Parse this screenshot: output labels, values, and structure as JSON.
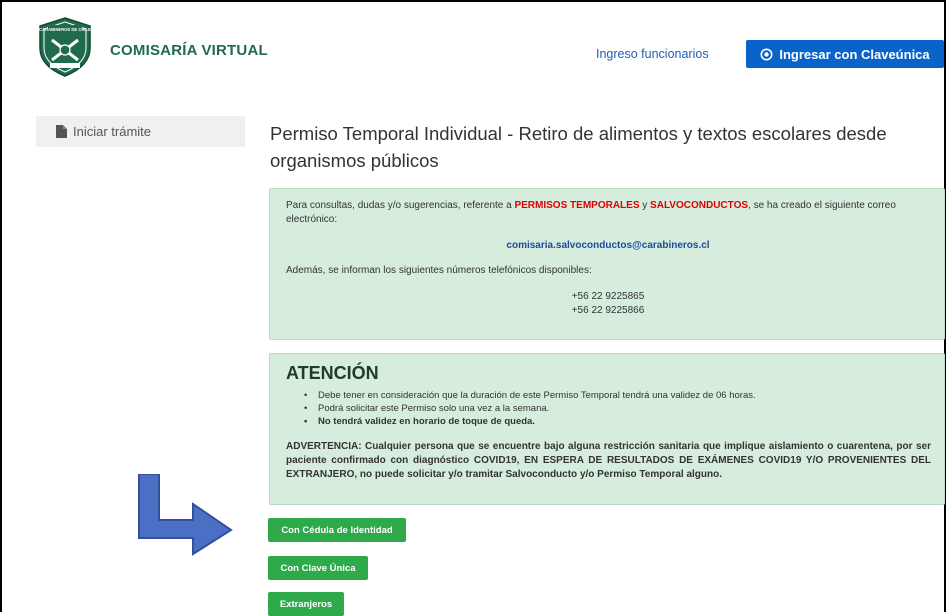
{
  "header": {
    "brand": "COMISARÍA VIRTUAL",
    "logo_text_top": "CARABINEROS DE CHILE",
    "nav_link": "Ingreso funcionarios",
    "login_button": "Ingresar con Claveúnica"
  },
  "sidebar": {
    "items": [
      {
        "label": "Iniciar trámite",
        "icon": "document-icon"
      }
    ]
  },
  "main": {
    "title": "Permiso Temporal Individual - Retiro de alimentos y textos escolares desde organismos públicos",
    "info_box": {
      "p1_before": "Para consultas, dudas y/o sugerencias, referente a ",
      "p1_red1": "PERMISOS TEMPORALES",
      "p1_mid": " y ",
      "p1_red2": "SALVOCONDUCTOS",
      "p1_after": ", se ha creado el siguiente correo electrónico:",
      "email": "comisaria.salvoconductos@carabineros.cl",
      "p2": "Además, se informan los siguientes números telefónicos disponibles:",
      "phones": [
        "+56 22 9225865",
        "+56 22 9225866"
      ]
    },
    "attention_box": {
      "title": "ATENCIÓN",
      "items": [
        "Debe tener en consideración que la duración de este Permiso Temporal tendrá una validez de 06 horas.",
        "Podrá solicitar este Permiso solo una vez a la semana.",
        "No tendrá validez en horario de toque de queda."
      ],
      "warning": "ADVERTENCIA: Cualquier persona que se encuentre bajo alguna restricción sanitaria que implique aislamiento o cuarentena, por ser paciente confirmado con diagnóstico COVID19, EN ESPERA DE RESULTADOS DE EXÁMENES COVID19 Y/O PROVENIENTES DEL EXTRANJERO, no puede solicitar y/o tramitar Salvoconducto y/o Permiso Temporal alguno."
    },
    "buttons": {
      "cedula": "Con Cédula de Identidad",
      "clave_unica": "Con Clave Única",
      "extranjeros": "Extranjeros"
    }
  },
  "colors": {
    "brand_green": "#1f6b4c",
    "primary_blue": "#0a63c9",
    "box_green": "#d6ecdc",
    "button_green": "#2eaa4a",
    "alert_red": "#e00000",
    "arrow_blue": "#4a6fc4"
  }
}
